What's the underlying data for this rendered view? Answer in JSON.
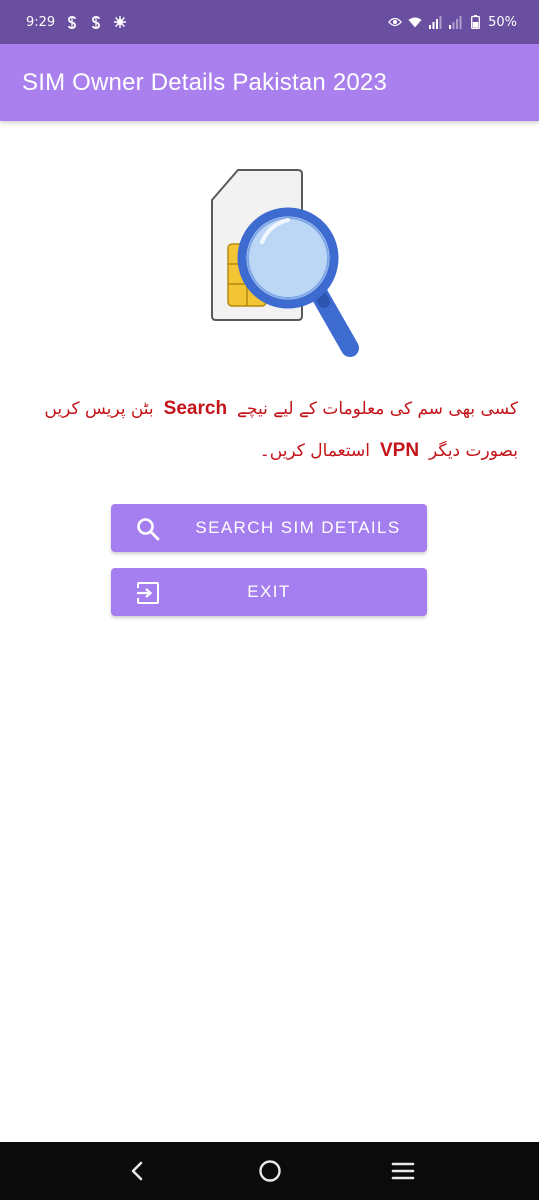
{
  "status_bar": {
    "time": "9:29",
    "battery": "50%",
    "icons": [
      "sim-s-icon",
      "sim-s-icon",
      "notification-icon",
      "eye-icon",
      "wifi-icon",
      "signal-icon",
      "signal-weak-icon",
      "battery-icon"
    ]
  },
  "app_bar": {
    "title": "SIM Owner Details Pakistan 2023"
  },
  "instructions": {
    "part1": "کسی بھی سم کی معلومات کے لیے نیچے",
    "keyword": "Search",
    "part2": "بٹن پریس کریں بصورت دیگر",
    "vpn": "VPN",
    "part3": "استعمال کریں۔"
  },
  "buttons": {
    "search_label": "SEARCH SIM DETAILS",
    "exit_label": "EXIT"
  },
  "colors": {
    "status_bar": "#6a4fa0",
    "app_bar": "#a980ee",
    "button": "#a57ff0",
    "text_red": "#c4141a",
    "nav_bar": "#0b0b0b"
  }
}
